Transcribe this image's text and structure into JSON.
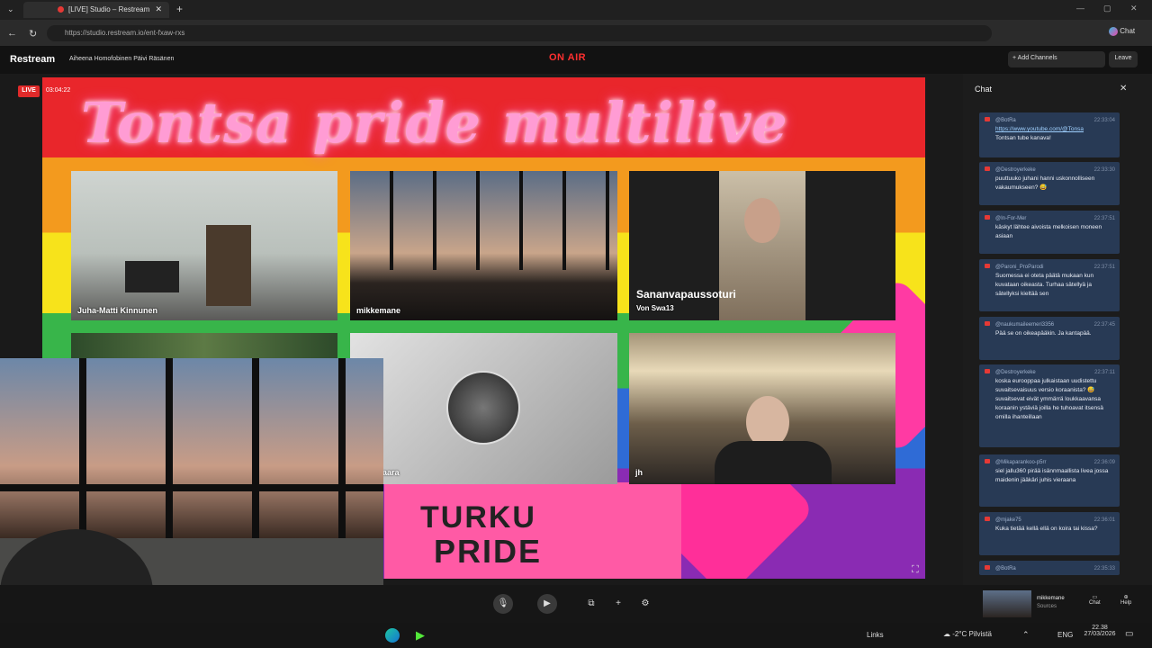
{
  "browser": {
    "tab_title": "[LIVE] Studio – Restream",
    "url": "https://studio.restream.io/ent-fxaw-rxs",
    "new_tab": "+",
    "chat_label": "Chat"
  },
  "studio": {
    "logo": "Restream",
    "title": "Aiheena Homofobinen Päivi Räsänen",
    "on_air": "ON AIR",
    "add_channels": "+ Add Channels",
    "leave": "Leave"
  },
  "stage": {
    "live_badge": "LIVE",
    "timer": "03:04:22",
    "banner": "Tontsa pride multilive"
  },
  "participants": [
    {
      "name": "Juha-Matti Kinnunen"
    },
    {
      "name": "mikkemane"
    },
    {
      "name": "Sananvapaussoturi",
      "subtitle": "Von Swa13"
    },
    {
      "name": "aara"
    },
    {
      "name": "jh"
    }
  ],
  "shirt_text": [
    "TURKU",
    "PRIDE"
  ],
  "chat": {
    "header": "Chat",
    "messages": [
      {
        "user": "@BotRa",
        "time": "22:33:04",
        "text": "Tontsan tube kanava!",
        "link": "https://www.youtube.com/@Tonsa"
      },
      {
        "user": "@Destroyerkeke",
        "time": "22:33:30",
        "text": "puuttuuko juhani hanni uskonnolliseen vakaumukseen? 😅"
      },
      {
        "user": "@In-For-Mer",
        "time": "22:37:51",
        "text": "käskyt lähtee aivoista melkoisen moneen asiaan"
      },
      {
        "user": "@Paroni_ProParodi",
        "time": "22:37:51",
        "text": "Suomessa ei oteta päätä mukaan kun kuvataan oikeasta. Turhaa sätellyä ja sätellyksi kieltää sen"
      },
      {
        "user": "@naukumaileemeri3356",
        "time": "22:37:45",
        "text": "Pää se on oikeapääkin. Ja kantapää."
      },
      {
        "user": "@Destroyerkeke",
        "time": "22:37:11",
        "text": "koska eurooppaa julkaistaan uudistettu suvaitsevaisuus versio koraanista? 😅 suvaitsevat eivät ymmärrä loukkaavansa koraanin ystäviä joilla he tuhoavat itsensä omilla ihanteillaan"
      },
      {
        "user": "@Mikaparankoo-p5rr",
        "time": "22:36:09",
        "text": "siel jallu360 pirää isännmaallista livea jossa maidenin jääkäri juhis vieraana"
      },
      {
        "user": "@mjake75",
        "time": "22:36:01",
        "text": "Kuka tietää kellä ellä on koira tai kissa?"
      },
      {
        "user": "@BotRa",
        "time": "22:35:33",
        "text": ""
      }
    ]
  },
  "toolbar": {
    "user": "mikkemane",
    "user_sub": "Sources",
    "chat": "Chat",
    "help": "Help"
  },
  "taskbar": {
    "links": "Links",
    "weather": "-2°C Pilvistä",
    "lang": "ENG",
    "time": "22.38",
    "date": "27/03/2026"
  }
}
